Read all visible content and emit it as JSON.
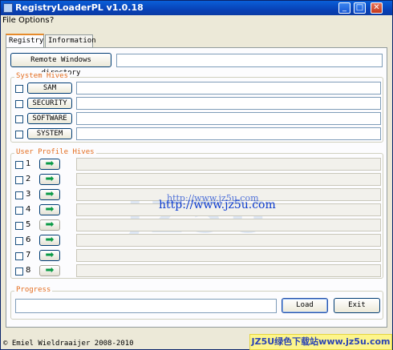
{
  "window": {
    "title": "RegistryLoaderPL v1.0.18",
    "minimize_glyph": "_",
    "maximize_glyph": "□",
    "close_glyph": "✕"
  },
  "menu": {
    "file": "File",
    "options": "Options",
    "help": "?"
  },
  "tabs": [
    {
      "label": "Registry",
      "active": true
    },
    {
      "label": "Information",
      "active": false
    }
  ],
  "remote": {
    "button_label": "Remote Windows directory",
    "value": ""
  },
  "system_hives": {
    "legend": "System Hives",
    "items": [
      {
        "label": "SAM",
        "checked": false,
        "value": ""
      },
      {
        "label": "SECURITY",
        "checked": false,
        "value": ""
      },
      {
        "label": "SOFTWARE",
        "checked": false,
        "value": ""
      },
      {
        "label": "SYSTEM",
        "checked": false,
        "value": ""
      }
    ]
  },
  "user_hives": {
    "legend": "User Profile Hives",
    "arrow_glyph": "➡",
    "items": [
      {
        "number": "1",
        "enabled": true
      },
      {
        "number": "2",
        "enabled": true
      },
      {
        "number": "3",
        "enabled": true
      },
      {
        "number": "4",
        "enabled": true
      },
      {
        "number": "5",
        "enabled": false
      },
      {
        "number": "6",
        "enabled": true
      },
      {
        "number": "7",
        "enabled": true
      },
      {
        "number": "8",
        "enabled": false
      }
    ]
  },
  "progress": {
    "legend": "Progress",
    "percent": 0
  },
  "actions": {
    "load": "Load",
    "exit": "Exit"
  },
  "status_text": "© Emiel Wieldraaijer 2008-2010",
  "watermark": {
    "url_small": "http://www.jz5u.com",
    "url_large": "http://www.jz5u.com",
    "brand": "JZ5U绿色下载站www.jz5u.com"
  },
  "colors": {
    "title_bar": "#0842b7",
    "legend_text": "#e46f22",
    "active_tab_accent": "#e68b2c",
    "arrow_green": "#0a9a45"
  }
}
